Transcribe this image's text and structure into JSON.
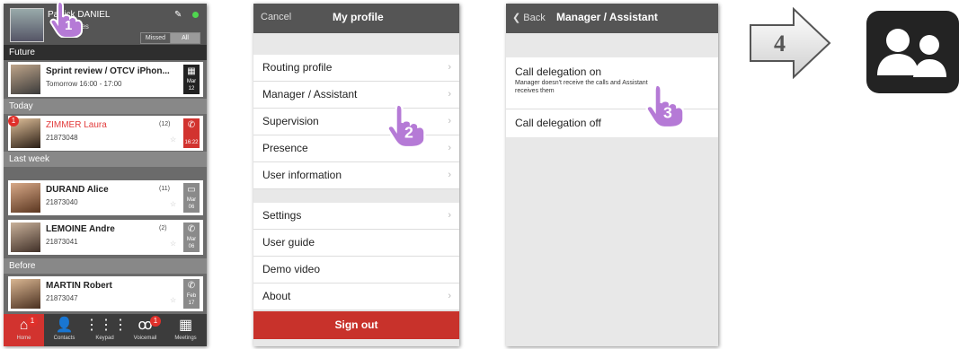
{
  "panel1": {
    "user": {
      "name": "Patrick DANIEL",
      "status": "...vices"
    },
    "filters": [
      "Missed",
      "All"
    ],
    "sections": [
      "Future",
      "Today",
      "Last week",
      "Before"
    ],
    "rows": [
      {
        "name": "Sprint review / OTCV iPhon...",
        "sub": "Tomorrow 16:00 - 17:00",
        "tile_top": "Mar",
        "tile_bottom": "12"
      },
      {
        "name": "ZIMMER Laura",
        "sub": "21873048",
        "count": "(12)",
        "tile_bottom": "16:22",
        "badge": "1"
      },
      {
        "name": "DURAND Alice",
        "sub": "21873040",
        "count": "(11)",
        "tile_top": "Mar",
        "tile_bottom": "06"
      },
      {
        "name": "LEMOINE Andre",
        "sub": "21873041",
        "count": "(2)",
        "tile_top": "Mar",
        "tile_bottom": "06"
      },
      {
        "name": "MARTIN Robert",
        "sub": "21873047",
        "tile_top": "Feb",
        "tile_bottom": "17"
      }
    ],
    "nav": [
      {
        "label": "Home",
        "icon": "home-icon",
        "badge": "1"
      },
      {
        "label": "Contacts",
        "icon": "contacts-icon"
      },
      {
        "label": "Keypad",
        "icon": "keypad-icon"
      },
      {
        "label": "Voicemail",
        "icon": "voicemail-icon",
        "badge": "1"
      },
      {
        "label": "Meetings",
        "icon": "calendar-icon"
      }
    ]
  },
  "panel2": {
    "cancel": "Cancel",
    "title": "My profile",
    "items1": [
      "Routing profile",
      "Manager / Assistant",
      "Supervision",
      "Presence",
      "User information"
    ],
    "items2": [
      "Settings",
      "User guide",
      "Demo video",
      "About"
    ],
    "sign_out": "Sign out"
  },
  "panel3": {
    "back": "Back",
    "title": "Manager / Assistant",
    "option1_title": "Call delegation on",
    "option1_desc": "Manager doesn't receive the calls and Assistant receives them",
    "option2_title": "Call delegation off"
  },
  "steps": [
    "1",
    "2",
    "3",
    "4"
  ],
  "colors": {
    "accent_red": "#c8322b",
    "header": "#555555",
    "status_green": "#4fd64f"
  }
}
